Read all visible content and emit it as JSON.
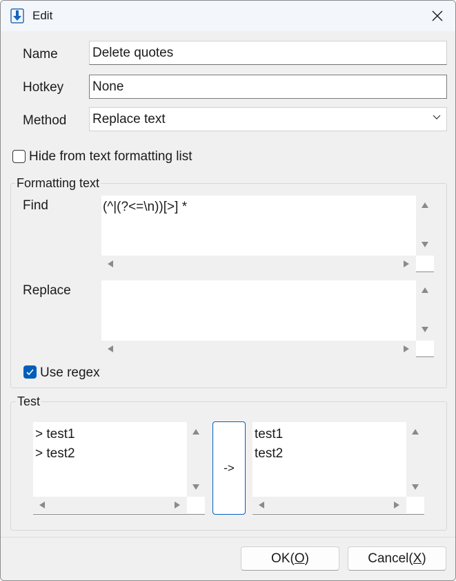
{
  "window": {
    "title": "Edit"
  },
  "form": {
    "name_label": "Name",
    "name_value": "Delete quotes",
    "hotkey_label": "Hotkey",
    "hotkey_value": "None",
    "method_label": "Method",
    "method_value": "Replace text"
  },
  "hide_checkbox": {
    "label": "Hide from text formatting list",
    "checked": false
  },
  "formatting": {
    "group_label": "Formatting text",
    "find_label": "Find",
    "find_value": "(^|(?<=\\n))[>] *",
    "replace_label": "Replace",
    "replace_value": "",
    "regex_label": "Use regex",
    "regex_checked": true
  },
  "test": {
    "group_label": "Test",
    "input_lines": [
      "> test1",
      "> test2"
    ],
    "run_label": "->",
    "output_lines": [
      "test1",
      "test2"
    ]
  },
  "buttons": {
    "ok": "OK",
    "ok_key": "O",
    "cancel": "Cancel",
    "cancel_key": "X"
  },
  "colors": {
    "accent": "#005fb8",
    "background": "#f0f0f0",
    "titlebar": "#f3f6fb"
  },
  "icons": {
    "app": "download-arrow-icon",
    "close": "close-icon",
    "dropdown": "chevron-down-icon",
    "check": "checkmark-icon"
  }
}
